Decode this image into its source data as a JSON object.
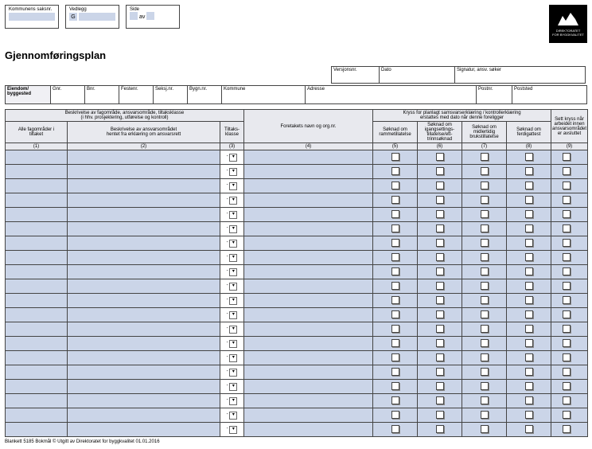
{
  "top": {
    "saksnr_label": "Kommunens saksnr.",
    "vedlegg_label": "Vedlegg",
    "vedlegg_letter": "G",
    "side_label": "Side",
    "side_av": "av"
  },
  "logo": {
    "line1": "DIREKTORATET",
    "line2": "FOR BYGGKVALITET"
  },
  "title": "Gjennomføringsplan",
  "meta": {
    "versjon": "Versjonsnr.",
    "dato": "Dato",
    "sign": "Signatur, ansv. søker"
  },
  "eiendom": {
    "label": "Eiendom/\nbyggested",
    "gnr": "Gnr.",
    "bnr": "Bnr.",
    "festenr": "Festenr.",
    "seksjnr": "Seksj.nr.",
    "bygnnr": "Bygn.nr.",
    "kommune": "Kommune",
    "adresse": "Adresse",
    "postnr": "Postnr.",
    "poststed": "Poststed"
  },
  "head": {
    "beskrivelse": "Beskrivelse av fagområde, ansvarsområde, tiltaksklasse\n(i hhv. prosjektering, utførelse og kontroll)",
    "foretak": "Foretakets navn og org.nr.",
    "kryss": "Kryss for planlagt samsvarserklæring / kontrollerklæring\nerstattes med dato når denne foreligger",
    "sett": "Sett kryss når arbeidet innen ansvarsområdet er avsluttet",
    "c1": "Alle fagområder i\ntiltaket",
    "c2": "Beskrivelse av ansvarsområdet\nhentet fra erklæring om ansvarsrett",
    "c3": "Tiltaks-\nklasse",
    "c5": "Søknad om\nrammetillatelse",
    "c6": "Søknad om\nigangsettings-\ntillatelse/ett-\ntrinnsøknad",
    "c7": "Søknad om\nmidlertidig\nbrukstillatelse",
    "c8": "Søknad om\nferdigattest",
    "n1": "(1)",
    "n2": "(2)",
    "n3": "(3)",
    "n4": "(4)",
    "n5": "(5)",
    "n6": "(6)",
    "n7": "(7)",
    "n8": "(8)",
    "n9": "(9)"
  },
  "dash": "-",
  "dd_sym": "▾",
  "rows": 20,
  "footer": "Blankett 5185 Bokmål   © Utgitt av Direktoratet for byggkvalitet 01.01.2016"
}
